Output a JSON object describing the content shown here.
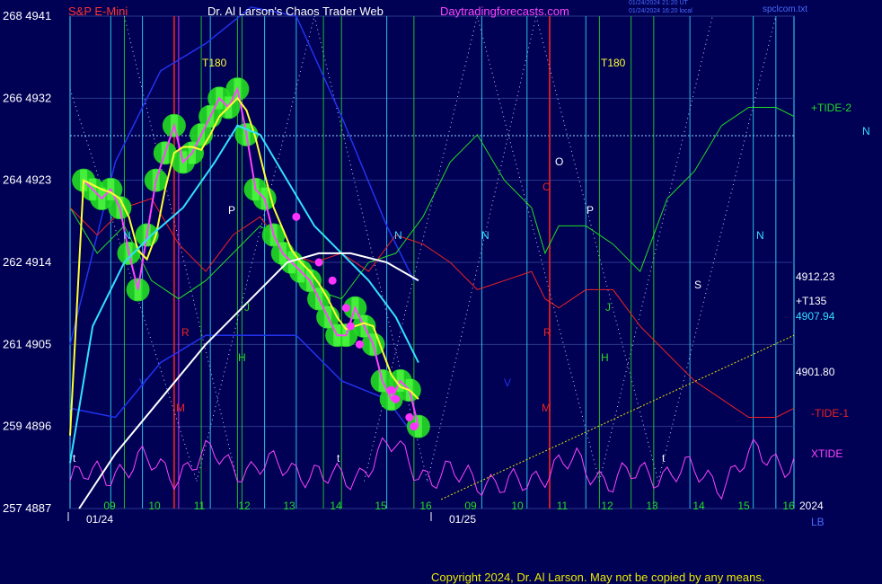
{
  "header": {
    "symbol": "S&P E-Mini",
    "title": "Dr. Al Larson's Chaos Trader Web",
    "site": "Daytradingforecasts.com",
    "stamp1": "01/24/2024 21:20 UT",
    "stamp2": "01/24/2024 16:20 local",
    "file": "spclcom.txt",
    "copyright": "Copyright 2024, Dr. Al Larson. May not be copied by any means."
  },
  "colors": {
    "background": "#000055",
    "price": "#ff44ff",
    "envelope": "#22dd22",
    "fast_ma": "#ffff33",
    "mid_ma": "#33e0ff",
    "slow_ma": "#ffffff",
    "tide_plus": "#22dd22",
    "tide_minus": "#ee2222",
    "xtide": "#ff44ff",
    "band": "#2233ee"
  },
  "chart_data": {
    "type": "line",
    "ylim": [
      4887,
      4941
    ],
    "y_ticks": [
      {
        "left": "257",
        "price": "4887"
      },
      {
        "left": "259",
        "price": "4896"
      },
      {
        "left": "261",
        "price": "4905"
      },
      {
        "left": "262",
        "price": "4914"
      },
      {
        "left": "264",
        "price": "4923"
      },
      {
        "left": "266",
        "price": "4932"
      },
      {
        "left": "268",
        "price": "4941"
      }
    ],
    "x_hours_day1": [
      "09",
      "10",
      "11",
      "12",
      "13",
      "14",
      "15",
      "16"
    ],
    "x_hours_day2": [
      "09",
      "10",
      "11",
      "12",
      "13",
      "14",
      "15",
      "16"
    ],
    "x_dates": [
      "01/24",
      "01/25"
    ],
    "x_year": "2024",
    "x_bottom_right": "LB",
    "right_labels": [
      {
        "text": "+TIDE-2",
        "color": "#22dd22"
      },
      {
        "text": "N",
        "color": "#33e0ff"
      },
      {
        "text": "4912.23",
        "color": "#ffffff"
      },
      {
        "text": "+T135",
        "color": "#ffffff"
      },
      {
        "text": "4907.94",
        "color": "#33e0ff"
      },
      {
        "text": "4901.80",
        "color": "#ffffff"
      },
      {
        "text": "-TIDE-1",
        "color": "#ee2222"
      },
      {
        "text": "XTIDE",
        "color": "#ff44ff"
      }
    ],
    "annotations": [
      {
        "text": "T180",
        "color": "#ffff33"
      },
      {
        "text": "T180",
        "color": "#ffff33"
      },
      {
        "text": "P",
        "color": "#ffffff"
      },
      {
        "text": "P",
        "color": "#ffffff"
      },
      {
        "text": "O",
        "color": "#ffffff"
      },
      {
        "text": "S",
        "color": "#ffffff"
      },
      {
        "text": "N",
        "color": "#33e0ff"
      },
      {
        "text": "N",
        "color": "#33e0ff"
      },
      {
        "text": "N",
        "color": "#33e0ff"
      },
      {
        "text": "N",
        "color": "#33e0ff"
      },
      {
        "text": "C",
        "color": "#ee2222"
      },
      {
        "text": "R",
        "color": "#ee2222"
      },
      {
        "text": "R",
        "color": "#ee2222"
      },
      {
        "text": "M",
        "color": "#ee2222"
      },
      {
        "text": "M",
        "color": "#ee2222"
      },
      {
        "text": "H",
        "color": "#22dd22"
      },
      {
        "text": "H",
        "color": "#22dd22"
      },
      {
        "text": "J",
        "color": "#22dd22"
      },
      {
        "text": "J",
        "color": "#22dd22"
      },
      {
        "text": "V",
        "color": "#2233ee"
      },
      {
        "text": "V",
        "color": "#2233ee"
      },
      {
        "text": "t",
        "color": "#ffffff"
      },
      {
        "text": "t",
        "color": "#ffffff"
      },
      {
        "text": "t",
        "color": "#ffffff"
      }
    ],
    "series": [
      {
        "name": "S&P E-Mini",
        "role": "price",
        "x": [
          0.3,
          0.5,
          0.7,
          0.9,
          1.1,
          1.3,
          1.5,
          1.7,
          1.9,
          2.1,
          2.3,
          2.5,
          2.7,
          2.9,
          3.1,
          3.3,
          3.5,
          3.7,
          3.9,
          4.1,
          4.3,
          4.5,
          4.7,
          4.9,
          5.1,
          5.3,
          5.5,
          5.7,
          5.9,
          6.1,
          6.3,
          6.5,
          6.7,
          6.9,
          7.1,
          7.3,
          7.5,
          7.7
        ],
        "values": [
          4923,
          4922,
          4921,
          4922,
          4920,
          4915,
          4911,
          4917,
          4923,
          4926,
          4929,
          4925,
          4926,
          4928,
          4930,
          4932,
          4931,
          4933,
          4928,
          4922,
          4921,
          4917,
          4915,
          4914,
          4913,
          4912,
          4910,
          4908,
          4906,
          4906,
          4909,
          4907,
          4905,
          4901,
          4899,
          4901,
          4900,
          4896
        ]
      },
      {
        "name": "+TIDE-2",
        "role": "tide_plus",
        "x": [
          0.0,
          0.6,
          1.2,
          1.8,
          2.4,
          3.0,
          3.6,
          4.2,
          4.8,
          5.4,
          6.0,
          6.6,
          7.2,
          7.8,
          8.4,
          9.0,
          9.6,
          10.2,
          10.5,
          10.8,
          11.4,
          12.0,
          12.6,
          13.2,
          13.8,
          14.4,
          15.0,
          15.6,
          16.0
        ],
        "values": [
          4920,
          4915,
          4918,
          4912,
          4910,
          4912,
          4915,
          4918,
          4916,
          4911,
          4910,
          4914,
          4915,
          4919,
          4925,
          4928,
          4923,
          4920,
          4915,
          4918,
          4918,
          4916,
          4913,
          4921,
          4924,
          4929,
          4931,
          4931,
          4930
        ]
      },
      {
        "name": "-TIDE-1",
        "role": "tide_minus",
        "x": [
          0.0,
          0.6,
          1.2,
          1.8,
          2.4,
          3.0,
          3.6,
          4.2,
          4.8,
          5.4,
          6.0,
          6.6,
          7.2,
          7.8,
          8.4,
          9.0,
          9.6,
          10.2,
          10.5,
          10.8,
          11.4,
          12.0,
          12.6,
          13.2,
          13.8,
          14.4,
          15.0,
          15.6,
          16.0
        ],
        "values": [
          4920,
          4917,
          4920,
          4921,
          4916,
          4913,
          4917,
          4919,
          4915,
          4914,
          4915,
          4913,
          4917,
          4916,
          4914,
          4911,
          4912,
          4913,
          4910,
          4909,
          4911,
          4911,
          4907,
          4904,
          4901,
          4899,
          4897,
          4897,
          4898
        ]
      },
      {
        "name": "XTIDE",
        "role": "xtide",
        "x": [
          0.0,
          0.8,
          1.6,
          2.4,
          3.2,
          4.0,
          4.8,
          5.6,
          6.4,
          7.2,
          8.0,
          8.8,
          9.6,
          10.4,
          11.2,
          12.0,
          12.8,
          13.6,
          14.4,
          15.2,
          16.0
        ],
        "values": [
          4890,
          4891,
          4892,
          4891,
          4893,
          4891,
          4892,
          4890,
          4891,
          4894,
          4890,
          4891,
          4889,
          4891,
          4892,
          4890,
          4891,
          4891,
          4890,
          4893,
          4892
        ]
      },
      {
        "name": "+T135",
        "role": "trendline",
        "x": [
          8.2,
          16.0
        ],
        "values": [
          4888,
          4906
        ]
      }
    ]
  }
}
